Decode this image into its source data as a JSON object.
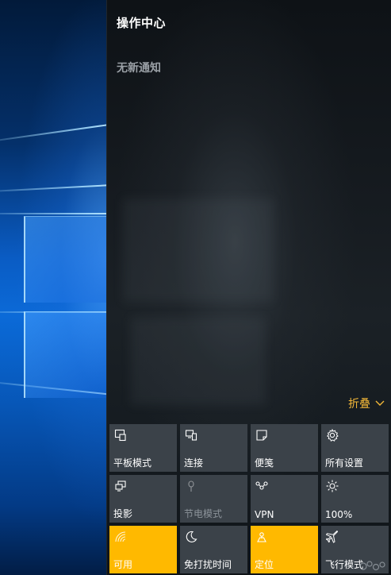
{
  "action_center": {
    "title": "操作中心",
    "empty_message": "无新通知",
    "collapse_label": "折叠",
    "accent_color": "#ffb900",
    "collapse_color": "#f2b738"
  },
  "quick_actions": [
    {
      "label": "平板模式",
      "icon": "tablet-mode-icon",
      "state": "off"
    },
    {
      "label": "连接",
      "icon": "connect-icon",
      "state": "off"
    },
    {
      "label": "便笺",
      "icon": "note-icon",
      "state": "off"
    },
    {
      "label": "所有设置",
      "icon": "gear-icon",
      "state": "off"
    },
    {
      "label": "投影",
      "icon": "project-icon",
      "state": "off"
    },
    {
      "label": "节电模式",
      "icon": "battery-saver-icon",
      "state": "disabled"
    },
    {
      "label": "VPN",
      "icon": "vpn-icon",
      "state": "off"
    },
    {
      "label": "100%",
      "icon": "brightness-icon",
      "state": "off"
    },
    {
      "label": "可用",
      "icon": "wifi-icon",
      "state": "on"
    },
    {
      "label": "免打扰时间",
      "icon": "moon-icon",
      "state": "off"
    },
    {
      "label": "定位",
      "icon": "location-icon",
      "state": "on"
    },
    {
      "label": "飞行模式",
      "icon": "airplane-icon",
      "state": "off"
    }
  ]
}
